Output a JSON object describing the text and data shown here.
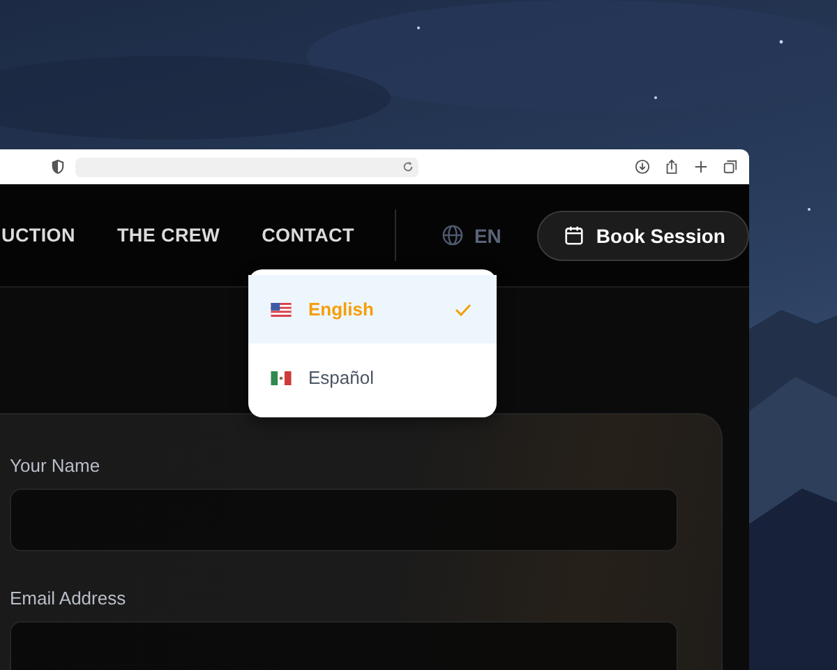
{
  "nav": {
    "links": [
      {
        "label": "UCTION"
      },
      {
        "label": "THE CREW"
      },
      {
        "label": "CONTACT"
      }
    ],
    "language": {
      "code": "EN"
    },
    "cta": {
      "label": "Book Session"
    }
  },
  "language_menu": {
    "options": [
      {
        "label": "English",
        "selected": true
      },
      {
        "label": "Español",
        "selected": false
      }
    ]
  },
  "form": {
    "fields": [
      {
        "label": "Your Name"
      },
      {
        "label": "Email Address"
      }
    ]
  }
}
